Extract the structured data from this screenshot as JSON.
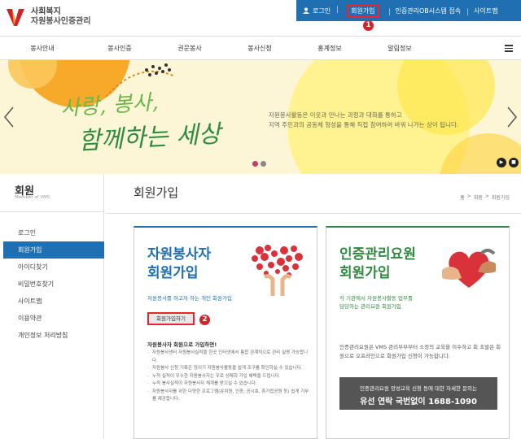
{
  "header": {
    "logo_line1": "사회복지",
    "logo_line2": "자원봉사인증관리",
    "util": {
      "login": "로그인",
      "join": "회원가입",
      "ob": "인증관리OB시스템 접속",
      "sitemap": "사이트맵"
    },
    "badge1": "1"
  },
  "gnb": {
    "items": [
      "봉사안내",
      "봉사인증",
      "권문봉사",
      "봉사신청",
      "홍계정보",
      "알림정보"
    ]
  },
  "banner": {
    "headline1": "사랑, 봉사,",
    "headline2": "함께하는 세상",
    "desc_line1": "자원봉사활동은 이웃과 만나는 과정과 대화를 통하고",
    "desc_line2": "지역 주민과의 공동체 형성을 통해 직접 참여하여 바꿔 나가는 상이 됩니다."
  },
  "sidebar": {
    "title": "회원",
    "subtitle": "Member of VMS",
    "items": [
      "로그인",
      "회원가입",
      "아이디찾기",
      "비밀번호찾기",
      "사이트맵",
      "이용약관",
      "개인정보 처리방침"
    ]
  },
  "main": {
    "title": "회원가입",
    "breadcrumb": [
      "홈",
      ">",
      "회원",
      ">",
      "회원가입"
    ]
  },
  "card_volunteer": {
    "title_line1": "자원봉사자",
    "title_line2": "회원가입",
    "subtitle": "자원봉사를 하고자 하는 개인 회원가입",
    "button": "회원가입하기",
    "badge2": "2",
    "notice_title": "자원봉사자 회원으로 가입하면!",
    "notices": [
      "자원봉사센터 자원봉사실적을 한곳 인터넷에서 통합 관계적으로 관리 실명 가능합니다.",
      "자원봉사 신청 기록은 정이기 자원봉사활동을 쉽게 조구를 확인하실 수 있습니다.",
      "누적 실적이 우수한 자원봉사자는 우로 상패회 가입 혜택을 드립니다.",
      "누적 봉사실적이 자원봉사자 체계를 받으실 수 있습니다.",
      "자원봉사자를 위한 다양한 프로그램(유치원, 인증, 공시효, 휴가접공원 등) 쉽게 기부를 제공합니다."
    ]
  },
  "card_manager": {
    "title_line1": "인증관리요원",
    "title_line2": "회원가입",
    "subtitle_line1": "각 기관에서 자원봉사활동 업무를",
    "subtitle_line2": "담당하는 관리요원 회원가입",
    "desc": "인증관리요원은 VMS 관리부부부터 소정의 교육을 이수하고 회 초발은 회원으로 오프라인으로 회원가입 신청이 가능합니다.",
    "box_line1": "인증관리요원 양성교육 신청 등에 대한 자세한 문의는",
    "box_line2": "유선 연락 국번없이 1688-1090"
  },
  "colors": {
    "primary_blue": "#1f6fb2",
    "primary_green": "#2e8b3f",
    "highlight_red": "#e8262b",
    "banner_bg": "#fdf6d6"
  }
}
